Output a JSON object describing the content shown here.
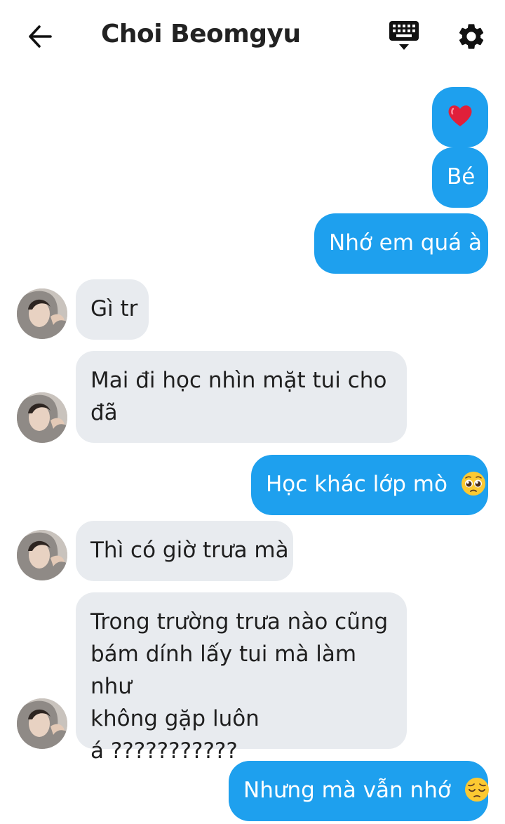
{
  "header": {
    "title": "Choi Beomgyu",
    "back_icon": "arrow-left-icon",
    "keyboard_icon": "keyboard-icon",
    "settings_icon": "gear-icon"
  },
  "messages": [
    {
      "side": "out",
      "text": "❤️"
    },
    {
      "side": "out",
      "text": "Bé"
    },
    {
      "side": "out",
      "text": "Nhớ em quá à"
    },
    {
      "side": "in",
      "text": "Gì tr"
    },
    {
      "side": "in",
      "lines": [
        "Mai đi học nhìn mặt tui cho",
        "đã"
      ]
    },
    {
      "side": "out",
      "text": "Học khác lớp mò",
      "emoji": "pleading-face"
    },
    {
      "side": "in",
      "text": "Thì có giờ trưa mà"
    },
    {
      "side": "in",
      "lines": [
        "Trong trường trưa nào cũng",
        "bám dính lấy tui mà làm như",
        "không gặp luôn",
        "á ???????????"
      ]
    },
    {
      "side": "out",
      "text": "Nhưng mà vẫn nhớ",
      "emoji": "pensive-face"
    }
  ],
  "colors": {
    "outgoing_bubble": "#1ea0ee",
    "incoming_bubble": "#e8ebef",
    "heart": "#e0203a"
  }
}
